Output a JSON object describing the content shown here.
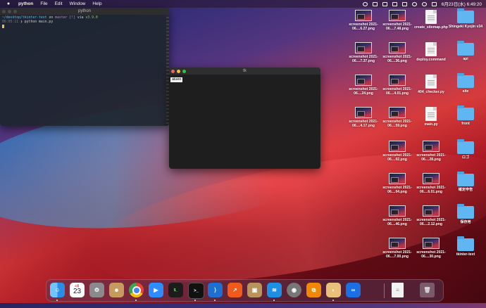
{
  "menubar": {
    "app_name": "python",
    "menus": [
      "File",
      "Edit",
      "Window",
      "Help"
    ],
    "datetime": "6月23日(水) 6:49:20"
  },
  "terminal": {
    "title": "python",
    "path": "~/desktop/tkinter-text",
    "on": "on",
    "branch": "master",
    "status": "[!]",
    "via": "via",
    "python_version": "v3.9.0",
    "time": "06:05:11",
    "prompt": "❯",
    "command": "python main.py"
  },
  "tk_window": {
    "title": "tk",
    "label": "aiueo"
  },
  "desktop_icons": [
    {
      "name": "screenshot 2021-06....6.27.png",
      "kind": "png"
    },
    {
      "name": "screenshot 2021-06....7.48.png",
      "kind": "png"
    },
    {
      "name": "create_sitemap.php",
      "kind": "doc"
    },
    {
      "name": "Shingeki Kyojin v34",
      "kind": "folder"
    },
    {
      "name": "screenshot 2021-06....7.37.png",
      "kind": "png"
    },
    {
      "name": "screenshot 2021-06....36.png",
      "kind": "png"
    },
    {
      "name": "deploy.command",
      "kind": "doc"
    },
    {
      "name": "api",
      "kind": "folder"
    },
    {
      "name": "screenshot 2021-06....24.png",
      "kind": "png"
    },
    {
      "name": "screenshot 2021-06....4.01.png",
      "kind": "png"
    },
    {
      "name": "404_checker.py",
      "kind": "doc"
    },
    {
      "name": "site",
      "kind": "folder"
    },
    {
      "name": "screenshot 2021-06....4.17.png",
      "kind": "png"
    },
    {
      "name": "screenshot 2021-06....59.png",
      "kind": "png"
    },
    {
      "name": "main.py",
      "kind": "doc"
    },
    {
      "name": "front",
      "kind": "folder"
    },
    {
      "name": "screenshot 2021-06....02.png",
      "kind": "png"
    },
    {
      "name": "screenshot 2021-06....28.png",
      "kind": "png"
    },
    {
      "name": "ロゴ",
      "kind": "folder"
    },
    {
      "name": "screenshot 2021-06....04.png",
      "kind": "png"
    },
    {
      "name": "screenshot 2021-06....6.01.png",
      "kind": "png"
    },
    {
      "name": "確定申告",
      "kind": "folder"
    },
    {
      "name": "screenshot 2021-06....46.png",
      "kind": "png"
    },
    {
      "name": "screenshot 2021-06....2.12.png",
      "kind": "png"
    },
    {
      "name": "保存用",
      "kind": "folder"
    },
    {
      "name": "screenshot 2021-06....7.00.png",
      "kind": "png"
    },
    {
      "name": "screenshot 2021-06....30.png",
      "kind": "png"
    },
    {
      "name": "tkinter-text",
      "kind": "folder"
    }
  ],
  "dock": {
    "calendar_month": "6月",
    "calendar_day": "23",
    "apps": [
      "finder",
      "calendar",
      "system-preferences",
      "contacts",
      "chrome",
      "zoom",
      "activity-monitor",
      "terminal",
      "vscode",
      "instruments",
      "archive-utility",
      "docker",
      "disk-utility",
      "drawio",
      "python-launcher",
      "infinity",
      "document",
      "trash"
    ]
  }
}
